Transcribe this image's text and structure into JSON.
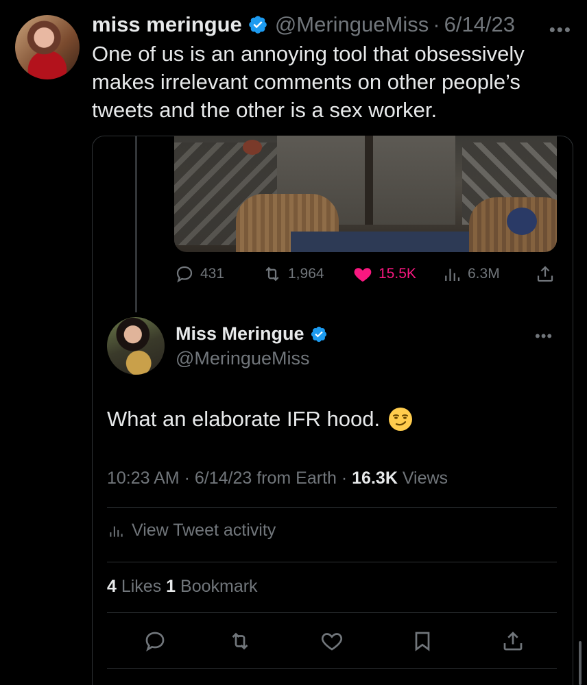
{
  "outer_tweet": {
    "display_name": "miss meringue",
    "handle": "@MeringueMiss",
    "separator": "·",
    "date": "6/14/23",
    "more": "•••",
    "text": "One of us is an annoying tool that obsessively makes irrelevant comments on other people’s tweets and the other is a sex worker."
  },
  "quoted": {
    "engagement": {
      "replies": "431",
      "retweets": "1,964",
      "likes": "15.5K",
      "views": "6.3M"
    }
  },
  "reply_tweet": {
    "display_name": "Miss Meringue",
    "handle": "@MeringueMiss",
    "more": "•••",
    "text": "What an elaborate IFR hood.",
    "emoji": "smirking-face",
    "meta": {
      "time": "10:23 AM",
      "sep1": " · ",
      "date": "6/14/23",
      "source": " from Earth",
      "sep2": " · ",
      "views_count": "16.3K",
      "views_label": " Views"
    },
    "activity_label": "View Tweet activity",
    "counts": {
      "likes_count": "4",
      "likes_label": " Likes ",
      "bookmarks_count": "1",
      "bookmarks_label": " Bookmark"
    },
    "actions": [
      "reply-icon",
      "retweet-icon",
      "like-icon",
      "bookmark-icon",
      "share-icon"
    ]
  },
  "colors": {
    "background": "#000000",
    "text": "#e7e9ea",
    "muted": "#71767b",
    "border": "#2f3336",
    "verified": "#1d9bf0",
    "like_active": "#f91880"
  }
}
